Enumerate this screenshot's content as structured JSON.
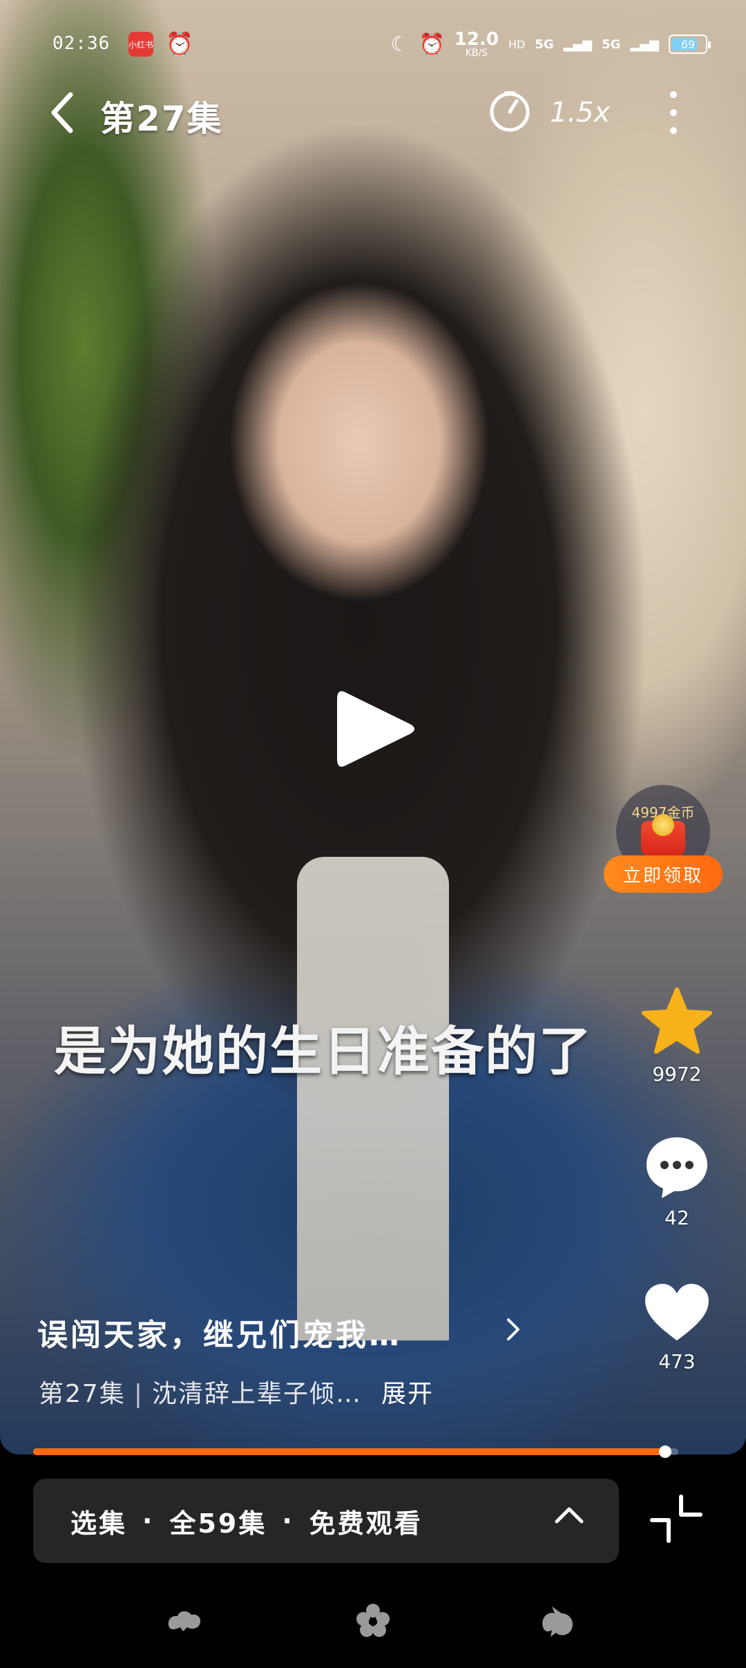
{
  "status_bar": {
    "time": "02:36",
    "app_badge": "小红书",
    "net_speed": "12.0",
    "net_unit": "KB/S",
    "signal1": "5G",
    "signal2": "5G",
    "battery": "69"
  },
  "header": {
    "title": "第27集",
    "speed": "1.5x"
  },
  "reward": {
    "amount": "4997金币",
    "button": "立即领取"
  },
  "subtitle": "是为她的生日准备的了",
  "actions": {
    "favorite_count": "9972",
    "comment_count": "42",
    "like_count": "473"
  },
  "series": {
    "title": "误闯天家，继兄们宠我…",
    "episode": "第27集",
    "synopsis": "沈清辞上辈子倾…",
    "expand": "展开"
  },
  "progress": 0.98,
  "episodes_bar": {
    "select": "选集",
    "total": "全59集",
    "free": "免费观看"
  },
  "colors": {
    "accent": "#ff6a10",
    "star": "#f7b21a"
  },
  "icons": [
    "back-icon",
    "timer-icon",
    "more-icon",
    "play-icon",
    "star-icon",
    "comment-icon",
    "heart-icon",
    "chevron-right-icon",
    "chevron-up-icon",
    "collapse-icon"
  ]
}
